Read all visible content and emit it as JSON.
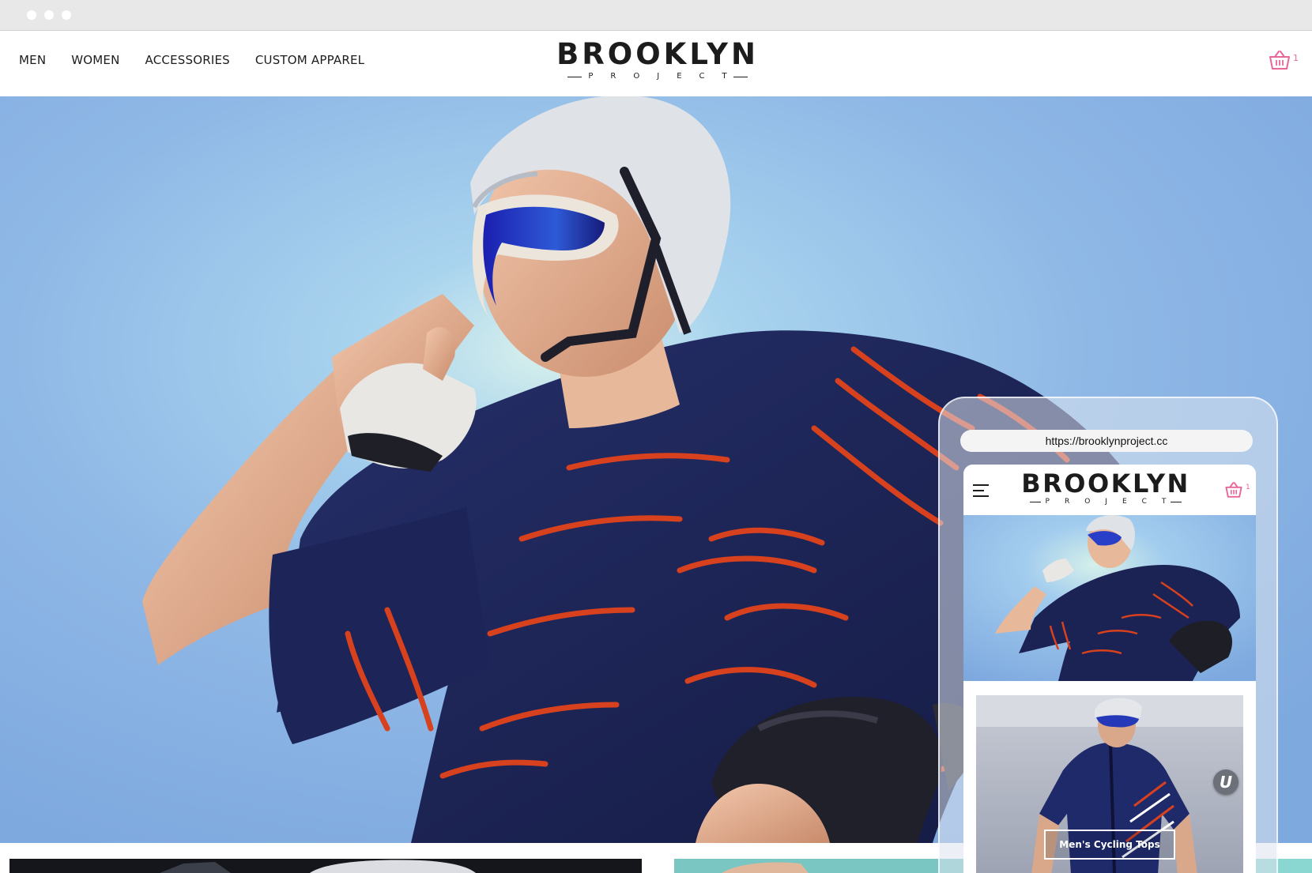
{
  "nav": {
    "items": [
      "MEN",
      "WOMEN",
      "ACCESSORIES",
      "CUSTOM APPAREL"
    ]
  },
  "logo": {
    "main": "BROOKLYN",
    "sub": "PROJECT"
  },
  "cart": {
    "count": "1",
    "icon": "basket-icon",
    "color": "#e8679a"
  },
  "hero": {
    "image": "cyclist in navy jersey with orange stripes, white helmet and blue sunglasses against blue sky"
  },
  "phone": {
    "url": "https://brooklynproject.cc",
    "logo_main": "BROOKLYN",
    "logo_sub": "PROJECT",
    "cart_count": "1",
    "card_label": "Men's Cycling Tops",
    "badge": "U"
  },
  "colors": {
    "accent": "#e8679a",
    "text": "#1c1c1c",
    "jersey": "#1b2254",
    "stripe": "#d8411e",
    "sky": "#8fb8e6"
  }
}
